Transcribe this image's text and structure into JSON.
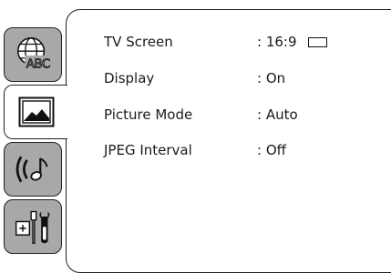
{
  "sidebar": {
    "tabs": [
      {
        "icon": "globe-abc-icon",
        "text": "ABC",
        "active": false
      },
      {
        "icon": "picture-icon",
        "active": true
      },
      {
        "icon": "audio-icon",
        "active": false
      },
      {
        "icon": "tools-icon",
        "active": false
      }
    ]
  },
  "settings": {
    "rows": [
      {
        "label": "TV Screen",
        "value": ": 16:9",
        "icon": "aspect-ratio-icon"
      },
      {
        "label": "Display",
        "value": ": On"
      },
      {
        "label": "Picture Mode",
        "value": ": Auto"
      },
      {
        "label": "JPEG Interval",
        "value": ": Off"
      }
    ]
  },
  "colors": {
    "inactive_tab": "#a8a8a8",
    "active_tab": "#ffffff",
    "outline": "#222222"
  }
}
